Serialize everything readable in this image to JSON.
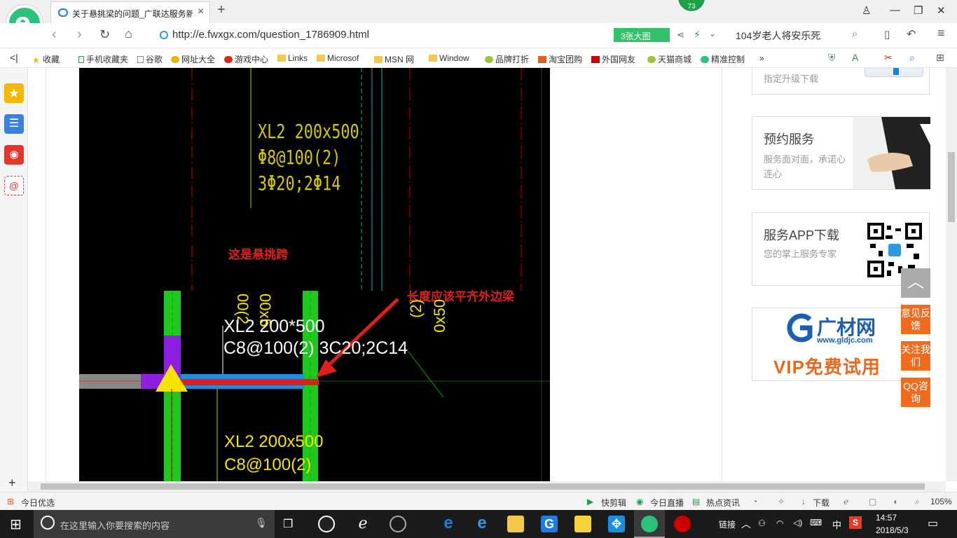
{
  "browser": {
    "tab_title": "关于悬挑梁的问题_广联达服务新干线",
    "badge_count": "73",
    "url": "http://e.fwxgx.com/question_1786909.html",
    "image_button": "3张大图",
    "search_text": "104岁老人将安乐死"
  },
  "bookmarks": [
    "收藏",
    "手机收藏夹",
    "谷歌",
    "网址大全",
    "游戏中心",
    "Links",
    "Microsof",
    "MSN 网",
    "Window",
    "品牌打折",
    "淘宝团购",
    "外国网友",
    "天猫商城",
    "精准控制"
  ],
  "cad": {
    "top_label_line1": "XL2 200x500",
    "top_label_line2": "Φ8@100(2)",
    "top_label_line3": "3Φ20;2Φ14",
    "annotation_cantilever": "这是悬挑跨",
    "annotation_length": "长度应该平齐外边梁",
    "mid_label_line1": "XL2 200*500",
    "mid_label_line2": "C8@100(2) 3C20;2C14",
    "bottom_label_line1": "XL2 200x500",
    "bottom_label_line2": "C8@100(2)",
    "vertical_label_a": "00(2",
    "vertical_label_b": "00x5",
    "vertical_label_c": "(2)",
    "vertical_label_d": "0x50"
  },
  "sidebar": {
    "upgrade_text": "指定升级下载",
    "service_title": "预约服务",
    "service_desc": "服务面对面，承诺心连心",
    "app_title": "服务APP下载",
    "app_desc": "您的掌上服务专家",
    "ad_brand": "广材网",
    "ad_url": "www.gldjc.com",
    "ad_vip": "VIP免费试用",
    "btn_feedback": "意见反馈",
    "btn_follow": "关注我们",
    "btn_qq": "QQ咨询"
  },
  "statusbar": {
    "left": "今日优选",
    "items": [
      "快剪辑",
      "今日直播",
      "热点资讯",
      "下载"
    ],
    "zoom": "105%"
  },
  "taskbar": {
    "search_placeholder": "在这里输入你要搜索的内容",
    "link_label": "链接",
    "ime": "中",
    "time": "14:57",
    "date": "2018/5/3"
  }
}
